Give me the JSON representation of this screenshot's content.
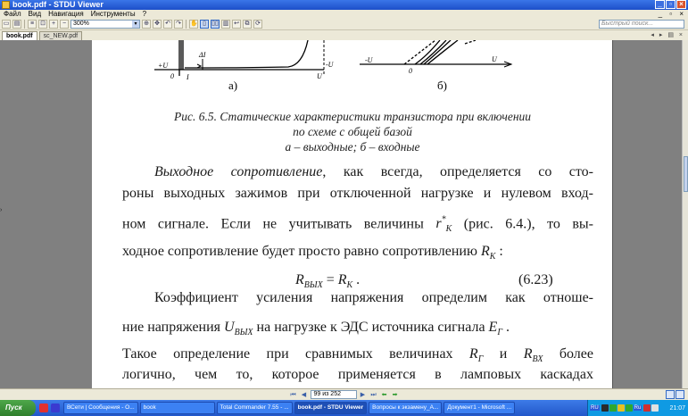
{
  "window": {
    "title": "book.pdf - STDU Viewer"
  },
  "menu": [
    "Файл",
    "Вид",
    "Навигация",
    "Инструменты",
    "?"
  ],
  "toolbar": {
    "zoom_value": "300%",
    "search_placeholder": "Быстрый поиск..."
  },
  "tabs": [
    {
      "label": "book.pdf",
      "active": true
    },
    {
      "label": "sc_NEW.pdf",
      "active": false
    }
  ],
  "document": {
    "figure": {
      "label_a": "а)",
      "label_b": "б)",
      "labels_a": [
        "+U",
        "0",
        "I",
        "ΔI",
        "-U",
        "U"
      ],
      "labels_b": [
        "-U",
        "0",
        "U"
      ]
    },
    "caption_line1": "Рис. 6.5. Статические характеристики транзистора при включении",
    "caption_line2": "по схеме с общей базой",
    "caption_line3": "а – выходные; б – входные",
    "p1_line1_em": "Выходное сопротивление",
    "p1_line1_rest": ", как всегда, определяется со сто-",
    "p1_line2": "роны выходных зажимов при отключенной нагрузке и нулевом вход-",
    "p1_line3_a": "ном сигнале. Если не учитывать величины ",
    "p1_line3_sym": "r",
    "p1_line3_sup": "*",
    "p1_line3_sub": "К",
    "p1_line3_b": " (рис. 6.4.), то вы-",
    "p1_line4_a": "ходное сопротивление будет просто равно сопротивлению ",
    "p1_line4_sym": "R",
    "p1_line4_sub": "К",
    "p1_line4_b": " :",
    "formula_lhs": "R",
    "formula_lhs_sub": "ВЫХ",
    "formula_eq": " = ",
    "formula_rhs": "R",
    "formula_rhs_sub": "К",
    "formula_end": " .",
    "formula_number": "(6.23)",
    "p2_line1": "Коэффициент усиления напряжения определим как отноше-",
    "p2_line2_a": "ние напряжения ",
    "p2_line2_sym1": "U",
    "p2_line2_sub1": "ВЫХ",
    "p2_line2_b": " на нагрузке к ЭДС источника сигнала ",
    "p2_line2_sym2": "E",
    "p2_line2_sub2": "Г",
    "p2_line2_c": " .",
    "p3_line1_a": "Такое определение при сравнимых величинах ",
    "p3_line1_sym1": "R",
    "p3_line1_sub1": "Г",
    "p3_line1_b": " и ",
    "p3_line1_sym2": "R",
    "p3_line1_sub2": "ВХ",
    "p3_line1_c": " более",
    "p3_line2": "логично, чем то, которое применяется в ламповых каскадах"
  },
  "statusbar": {
    "page_value": "99 из 252"
  },
  "taskbar": {
    "start_label": "Пуск",
    "tasks": [
      {
        "label": "ВСети | Сообщения - О...",
        "active": false
      },
      {
        "label": "book",
        "active": false
      },
      {
        "label": "Total Commander 7.55 - ...",
        "active": false
      },
      {
        "label": "book.pdf - STDU Viewer",
        "active": true
      },
      {
        "label": "Вопросы к экзамену_А...",
        "active": false
      },
      {
        "label": "Документ1 - Microsoft ...",
        "active": false
      }
    ],
    "lang": "RU",
    "lang2": "Ru",
    "clock": "21:07"
  }
}
